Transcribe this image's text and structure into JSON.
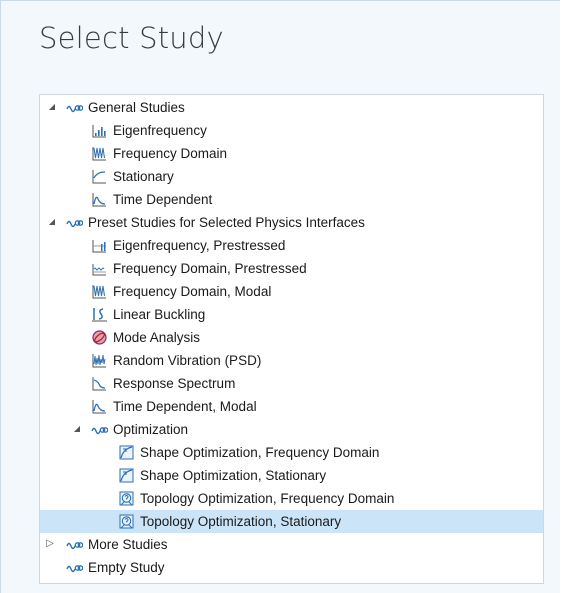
{
  "title": "Select Study",
  "tree": {
    "general": {
      "label": "General Studies",
      "items": [
        "Eigenfrequency",
        "Frequency Domain",
        "Stationary",
        "Time Dependent"
      ]
    },
    "preset": {
      "label": "Preset Studies for Selected Physics Interfaces",
      "items": [
        "Eigenfrequency, Prestressed",
        "Frequency Domain, Prestressed",
        "Frequency Domain, Modal",
        "Linear Buckling",
        "Mode Analysis",
        "Random Vibration (PSD)",
        "Response Spectrum",
        "Time Dependent, Modal"
      ],
      "optimization": {
        "label": "Optimization",
        "items": [
          "Shape Optimization, Frequency Domain",
          "Shape Optimization, Stationary",
          "Topology Optimization, Frequency Domain",
          "Topology Optimization, Stationary"
        ]
      }
    },
    "more": {
      "label": "More Studies"
    },
    "empty": {
      "label": "Empty Study"
    }
  },
  "colors": {
    "selection": "#cce4f7",
    "icon_blue": "#2c6fb4",
    "panel_bg": "#f3f8fc"
  }
}
